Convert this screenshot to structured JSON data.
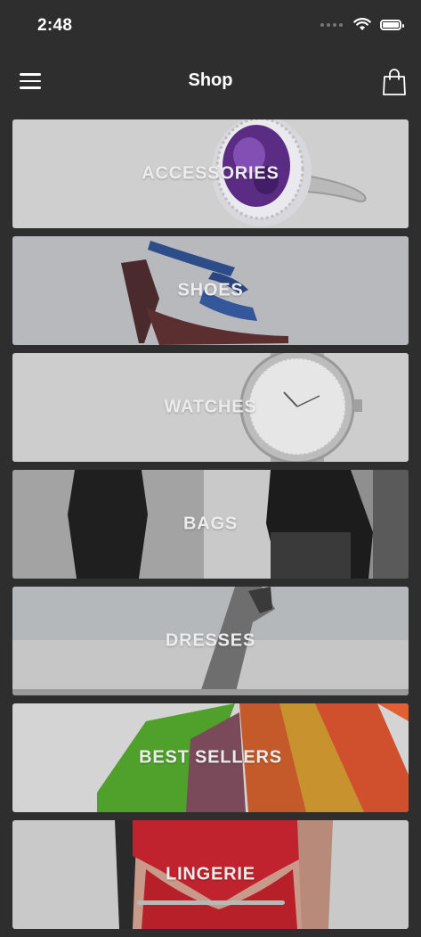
{
  "status_bar": {
    "time": "2:48",
    "icons": [
      "signal-dots-icon",
      "wifi-icon",
      "battery-icon"
    ]
  },
  "nav": {
    "title": "Shop",
    "left_icon": "hamburger-menu-icon",
    "right_icon": "shopping-bag-icon"
  },
  "categories": [
    {
      "label": "ACCESSORIES",
      "image": "amethyst-ring-image"
    },
    {
      "label": "SHOES",
      "image": "high-heel-sandal-image"
    },
    {
      "label": "WATCHES",
      "image": "wristwatch-image"
    },
    {
      "label": "BAGS",
      "image": "backpacks-image"
    },
    {
      "label": "DRESSES",
      "image": "dress-image"
    },
    {
      "label": "BEST SELLERS",
      "image": "shopping-bags-image"
    },
    {
      "label": "LINGERIE",
      "image": "red-lace-lingerie-image"
    }
  ],
  "colors": {
    "background": "#2e2e2e",
    "card_overlay": "#d9d9d9",
    "text": "#ffffff"
  }
}
